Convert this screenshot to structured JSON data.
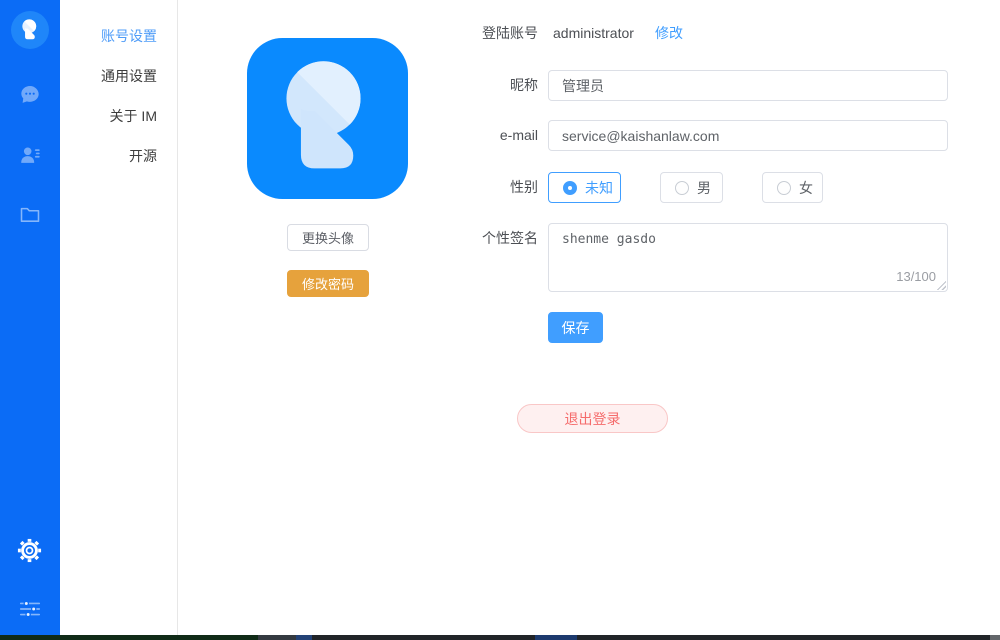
{
  "colors": {
    "sidebar_bg": "#0b6cf6",
    "accent_blue": "#409eff",
    "avatar_tile_blue": "#0a8afe",
    "warning_orange": "#e6a23c",
    "danger_red": "#f56c6c",
    "logout_bg": "#fef0f0"
  },
  "sidebar": {
    "icons": [
      "app-logo",
      "chat",
      "contacts",
      "folder",
      "settings-gear",
      "filters"
    ]
  },
  "menu": {
    "items": [
      {
        "label": "账号设置",
        "active": true
      },
      {
        "label": "通用设置",
        "active": false
      },
      {
        "label": "关于 IM",
        "active": false
      },
      {
        "label": "开源",
        "active": false
      }
    ]
  },
  "profile": {
    "change_avatar_label": "更换头像",
    "change_password_label": "修改密码"
  },
  "form": {
    "account_label": "登陆账号",
    "account_value": "administrator",
    "modify_link_label": "修改",
    "nickname_label": "昵称",
    "nickname_value": "管理员",
    "email_label": "e-mail",
    "email_value": "service@kaishanlaw.com",
    "gender_label": "性别",
    "gender_options": [
      {
        "label": "未知",
        "selected": true
      },
      {
        "label": "男",
        "selected": false
      },
      {
        "label": "女",
        "selected": false
      }
    ],
    "signature_label": "个性签名",
    "signature_value": "shenme gasdo",
    "signature_counter": "13/100",
    "save_label": "保存"
  },
  "logout_label": "退出登录"
}
